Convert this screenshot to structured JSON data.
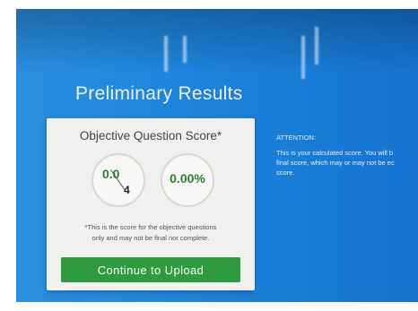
{
  "page": {
    "title": "Preliminary Results"
  },
  "card": {
    "title": "Objective Question Score*",
    "score": {
      "earned": "0.0",
      "possible": "4"
    },
    "percentage": "0.00%",
    "note_line1": "*This is the score for the objective questions",
    "note_line2": "only and may not be final nor complete.",
    "button_label": "Continue to Upload"
  },
  "attention": {
    "heading": "ATTENTION:",
    "line1": "This is your calculated score. You will b",
    "line2": "final score, which may or may not be ec",
    "line3": "score."
  },
  "colors": {
    "background": "#1f86dd",
    "button": "#2f9b3f",
    "score_text": "#2e7d2e"
  }
}
